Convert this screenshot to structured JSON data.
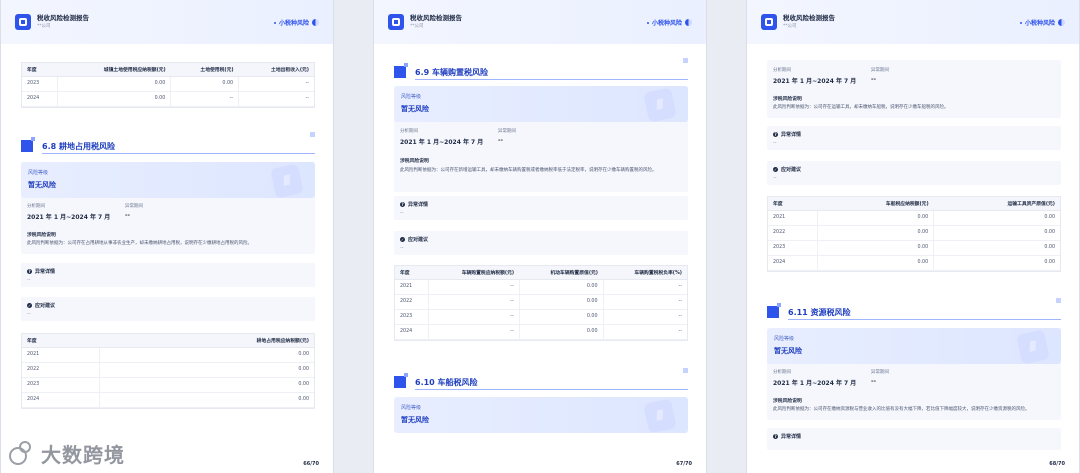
{
  "header": {
    "title": "税收风险检测报告",
    "subtitle": "**公司",
    "tag": "小税种风险"
  },
  "page1": {
    "top_table": {
      "headers": [
        "年度",
        "城镇土地使用税应纳税额(元)",
        "土地使用税(元)",
        "土地出租收入(元)"
      ],
      "rows": [
        [
          "2023",
          "0.00",
          "0.00",
          "--"
        ],
        [
          "2024",
          "0.00",
          "--",
          "--"
        ]
      ]
    },
    "section": {
      "title": "6.8 耕地占用税风险"
    },
    "risk": {
      "label": "风险等级",
      "value": "暂无风险"
    },
    "period_label": "分析期间",
    "period_value": "2021 年 1 月~2024 年 7 月",
    "abnormal_label": "异常期间",
    "abnormal_value": "--",
    "desc_title": "涉税风险说明",
    "desc_text": "此风险判断依据为：公司存在占用耕地从事非农业生产，却未缴纳耕地占用税，说明存在少缴耕地占用税的风险。",
    "detail_title": "异常详情",
    "detail_value": "--",
    "advice_title": "应对建议",
    "advice_value": "--",
    "bottom_table": {
      "headers": [
        "年度",
        "耕地占用税应纳税额(元)"
      ],
      "rows": [
        [
          "2021",
          "0.00"
        ],
        [
          "2022",
          "0.00"
        ],
        [
          "2023",
          "0.00"
        ],
        [
          "2024",
          "0.00"
        ]
      ]
    },
    "page_num": "66/70"
  },
  "page2": {
    "section1": {
      "title": "6.9 车辆购置税风险"
    },
    "risk": {
      "label": "风险等级",
      "value": "暂无风险"
    },
    "period_label": "分析期间",
    "period_value": "2021 年 1 月~2024 年 7 月",
    "abnormal_label": "异常期间",
    "abnormal_value": "--",
    "desc_title": "涉税风险说明",
    "desc_text": "此风险判断依据为：公司存在新增运输工具，却未缴纳车辆购置税或者缴纳税率低于法定税率，说明存在少缴车辆购置税的风险。",
    "detail_title": "异常详情",
    "detail_value": "--",
    "advice_title": "应对建议",
    "advice_value": "--",
    "table": {
      "headers": [
        "年度",
        "车辆购置税应纳税额(元)",
        "机动车辆购置原值(元)",
        "车辆购置税税负率(%)"
      ],
      "rows": [
        [
          "2021",
          "--",
          "0.00",
          "--"
        ],
        [
          "2022",
          "--",
          "0.00",
          "--"
        ],
        [
          "2023",
          "--",
          "0.00",
          "--"
        ],
        [
          "2024",
          "--",
          "0.00",
          "--"
        ]
      ]
    },
    "section2": {
      "title": "6.10 车船税风险"
    },
    "risk2": {
      "label": "风险等级",
      "value": "暂无风险"
    },
    "page_num": "67/70"
  },
  "page3": {
    "period_label": "分析期间",
    "period_value": "2021 年 1 月~2024 年 7 月",
    "abnormal_label": "异常期间",
    "abnormal_value": "--",
    "desc_title": "涉税风险说明",
    "desc_text": "此风险判断依据为：公司存在运输工具，却未缴纳车船税，说明存在少缴车船税的风险。",
    "detail_title": "异常详情",
    "detail_value": "--",
    "advice_title": "应对建议",
    "advice_value": "--",
    "table": {
      "headers": [
        "年度",
        "车船税应纳税额(元)",
        "运输工具资产原值(元)"
      ],
      "rows": [
        [
          "2021",
          "0.00",
          "0.00"
        ],
        [
          "2022",
          "0.00",
          "0.00"
        ],
        [
          "2023",
          "0.00",
          "0.00"
        ],
        [
          "2024",
          "0.00",
          "0.00"
        ]
      ]
    },
    "section": {
      "title": "6.11 资源税风险"
    },
    "risk": {
      "label": "风险等级",
      "value": "暂无风险"
    },
    "period_label2": "分析期间",
    "period_value2": "2021 年 1 月~2024 年 7 月",
    "abnormal_label2": "异常期间",
    "abnormal_value2": "--",
    "desc_title2": "涉税风险说明",
    "desc_text2": "此风险判断依据为：公司存在缴纳资源税与营业收入的比值有没有大幅下降，若比值下降幅度较大，说明存在少缴资源税的风险。",
    "detail_title2": "异常详情",
    "page_num": "68/70"
  },
  "watermark": {
    "text": "大数跨境"
  }
}
